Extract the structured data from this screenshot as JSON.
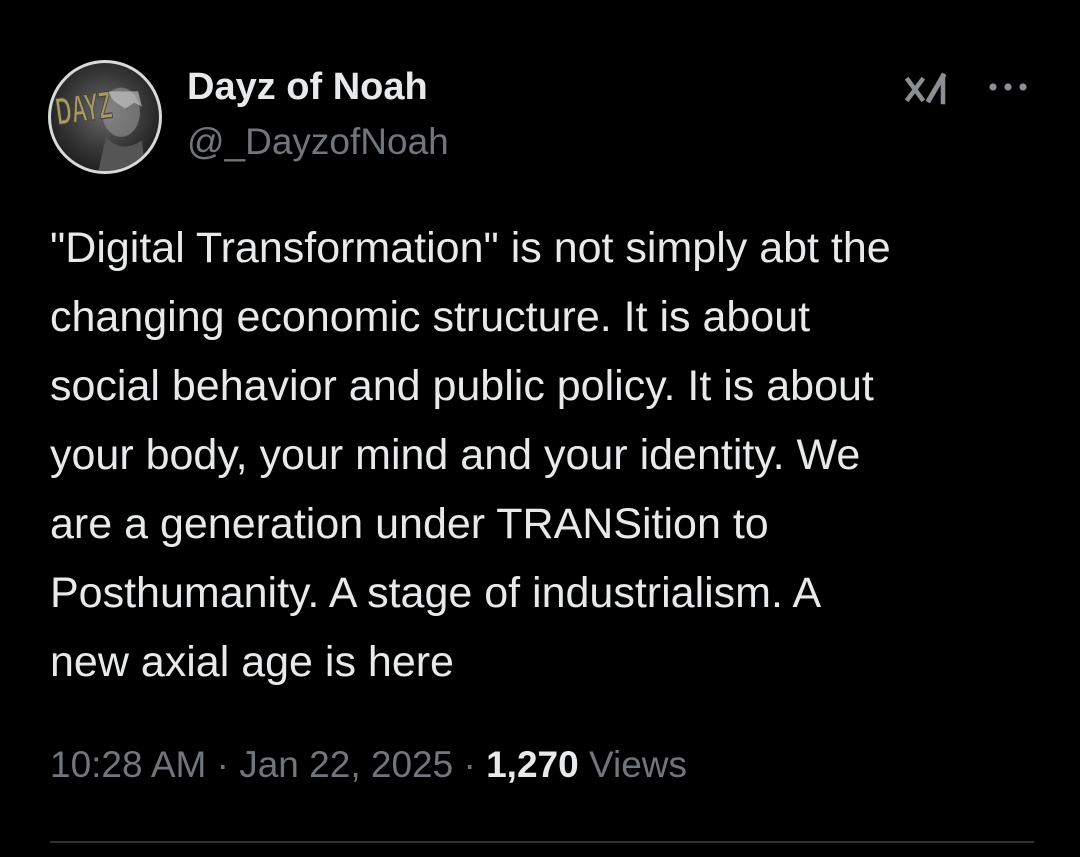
{
  "author": {
    "display_name": "Dayz of Noah",
    "handle": "@_DayzofNoah",
    "avatar_text": "DAYZ"
  },
  "header_icons": {
    "grok": "grok-icon",
    "more": "more-options-icon"
  },
  "tweet": {
    "text": "\"Digital Transformation\" is not simply abt the\nchanging economic structure. It is about\nsocial behavior and public policy. It is about\nyour body, your mind and your identity. We\nare a generation under TRANSition to\nPosthumanity. A stage of industrialism. A\nnew axial age is here"
  },
  "meta": {
    "time": "10:28 AM",
    "separator": " · ",
    "date": "Jan 22, 2025",
    "views_count": "1,270",
    "views_label": "Views"
  },
  "colors": {
    "background": "#000000",
    "primary_text": "#e7e9ea",
    "secondary_text": "#71767b",
    "divider": "#2f3336"
  }
}
